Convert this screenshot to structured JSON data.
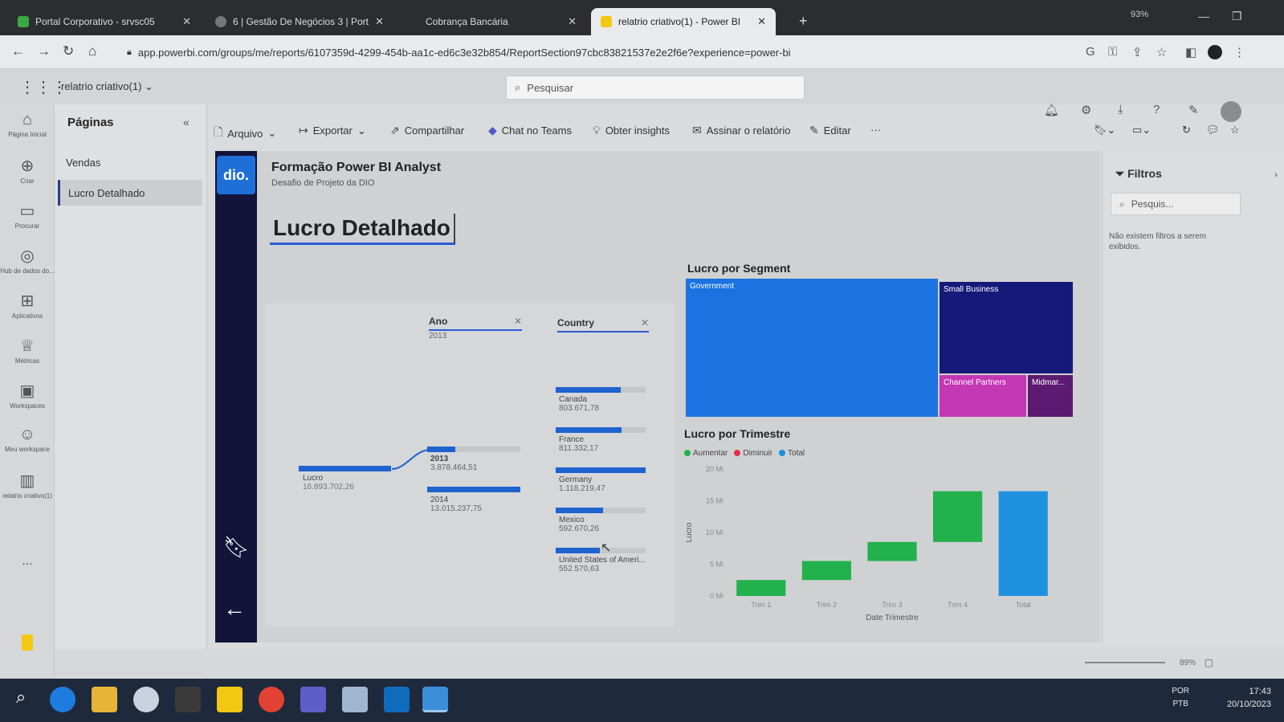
{
  "browser": {
    "tabs": [
      {
        "title": "Portal Corporativo - srvsc05",
        "color": "#3aa845"
      },
      {
        "title": "6 | Gestão De Negócios 3 | Porta",
        "color": "#777777"
      },
      {
        "title": "Cobrança Bancária",
        "color": "#2b2d30"
      },
      {
        "title": "relatrio criativo(1) - Power BI",
        "color": "#f2c811"
      }
    ],
    "url": "app.powerbi.com/groups/me/reports/6107359d-4299-454b-aa1c-ed6c3e32b854/ReportSection97cbc83821537e2e2f6e?experience=power-bi",
    "zoom_level": "93%"
  },
  "pbi": {
    "report_name": "relatrio criativo(1)",
    "search_placeholder": "Pesquisar",
    "leftnav": [
      {
        "icon": "home-icon",
        "label": "Página Inicial"
      },
      {
        "icon": "create-icon",
        "label": "Criar"
      },
      {
        "icon": "browse-icon",
        "label": "Procurar"
      },
      {
        "icon": "datahub-icon",
        "label": "Hub de dados do..."
      },
      {
        "icon": "apps-icon",
        "label": "Aplicativos"
      },
      {
        "icon": "metrics-icon",
        "label": "Métricas"
      },
      {
        "icon": "workspaces-icon",
        "label": "Workspaces"
      },
      {
        "icon": "myworkspace-icon",
        "label": "Meu workspace"
      },
      {
        "icon": "report-icon",
        "label": "relatrio criativo(1)"
      }
    ],
    "leftnav_more": "...",
    "pages_title": "Páginas",
    "pages": [
      "Vendas",
      "Lucro Detalhado"
    ],
    "actions": {
      "arquivo": "Arquivo",
      "exportar": "Exportar",
      "compartilhar": "Compartilhar",
      "chat_teams": "Chat no Teams",
      "insights": "Obter insights",
      "assinar": "Assinar o relatório",
      "editar": "Editar",
      "more": "···"
    },
    "filters": {
      "title": "Filtros",
      "search_placeholder": "Pesquis...",
      "empty": "Não existem filtros a serem exibidos."
    },
    "zoom": "89%"
  },
  "report": {
    "logo_text": "dio.",
    "title": "Formação Power BI Analyst",
    "subtitle": "Desafio de Projeto da DIO",
    "page_heading": "Lucro Detalhado",
    "decomp": {
      "root_label": "Lucro",
      "root_value": "16.893.702,26",
      "ano_header": "Ano",
      "ano_selected": "2013",
      "years": [
        {
          "label": "2013",
          "value": "3.878.464,51",
          "share": 0.3
        },
        {
          "label": "2014",
          "value": "13.015.237,75",
          "share": 1.0
        }
      ],
      "country_header": "Country",
      "countries": [
        {
          "label": "Canada",
          "value": "803.671,78",
          "share": 0.72
        },
        {
          "label": "France",
          "value": "811.332,17",
          "share": 0.73
        },
        {
          "label": "Germany",
          "value": "1.118.219,47",
          "share": 1.0
        },
        {
          "label": "Mexico",
          "value": "592.670,26",
          "share": 0.53
        },
        {
          "label": "United States of Ameri...",
          "value": "552.570,63",
          "share": 0.49
        }
      ]
    },
    "treemap": {
      "title": "Lucro por Segment",
      "cells": [
        {
          "label": "Government",
          "color": "#1a73e0"
        },
        {
          "label": "Small Business",
          "color": "#14197a"
        },
        {
          "label": "Channel Partners",
          "color": "#c437b5"
        },
        {
          "label": "Midmar...",
          "color": "#5c1a72"
        }
      ]
    }
  },
  "chart_data": {
    "type": "bar",
    "title": "Lucro por Trimestre",
    "xlabel": "Date Trimestre",
    "ylabel": "Lucro",
    "legend": [
      {
        "name": "Aumentar",
        "color": "#22b14c"
      },
      {
        "name": "Diminuir",
        "color": "#e0304a"
      },
      {
        "name": "Total",
        "color": "#1e90e0"
      }
    ],
    "categories": [
      "Trim 1",
      "Trim 2",
      "Trim 3",
      "Trim 4",
      "Total"
    ],
    "steps": [
      {
        "start": 0,
        "end": 2.5,
        "kind": "Aumentar"
      },
      {
        "start": 2.5,
        "end": 5.5,
        "kind": "Aumentar"
      },
      {
        "start": 5.5,
        "end": 8.5,
        "kind": "Aumentar"
      },
      {
        "start": 8.5,
        "end": 16.5,
        "kind": "Aumentar"
      },
      {
        "start": 0,
        "end": 16.5,
        "kind": "Total"
      }
    ],
    "ylim": [
      0,
      20
    ],
    "yticks": [
      "0 Mi",
      "5 Mi",
      "10 Mi",
      "15 Mi",
      "20 Mi"
    ]
  },
  "taskbar": {
    "lang": "POR",
    "lang2": "PTB",
    "time": "17:43",
    "date": "20/10/2023"
  }
}
